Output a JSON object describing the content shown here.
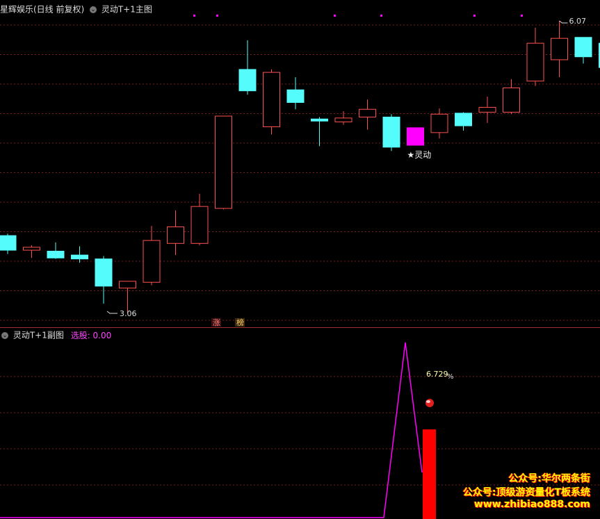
{
  "main_panel": {
    "title": "星辉娱乐(日线 前复权)",
    "indicator_name": "灵动T+1主图",
    "high_label": "6.07",
    "low_label": "3.06",
    "signal_label": "★灵动",
    "tag_zhang": "涨",
    "tag_bang": "榜"
  },
  "sub_panel": {
    "indicator_name": "灵动T+1副图",
    "select_label": "选股: 0.00",
    "percent_label": "6.729",
    "percent_suffix": "%"
  },
  "watermarks": {
    "line1": "公众号:华尔两条街",
    "line2": "公众号:顶级游资量化T板系统",
    "line3": "www.zhibiao888.com"
  },
  "colors": {
    "up": "#ff5050",
    "down": "#54fcfc",
    "signal": "#ff00ff",
    "grid": "#7a1e1e",
    "watermark": "#ffff00",
    "watermark_shadow": "#ff0000"
  },
  "chart_data": {
    "type": "candlestick",
    "price_range": [
      3.0,
      6.2
    ],
    "candles": [
      {
        "o": 3.86,
        "h": 3.88,
        "l": 3.67,
        "c": 3.71
      },
      {
        "o": 3.71,
        "h": 3.76,
        "l": 3.63,
        "c": 3.74,
        "flat": true
      },
      {
        "o": 3.7,
        "h": 3.79,
        "l": 3.62,
        "c": 3.63
      },
      {
        "o": 3.66,
        "h": 3.75,
        "l": 3.58,
        "c": 3.62
      },
      {
        "o": 3.62,
        "h": 3.65,
        "l": 3.16,
        "c": 3.34
      },
      {
        "o": 3.32,
        "h": 3.32,
        "l": 3.06,
        "c": 3.39
      },
      {
        "o": 3.38,
        "h": 3.96,
        "l": 3.35,
        "c": 3.81
      },
      {
        "o": 3.78,
        "h": 4.12,
        "l": 3.66,
        "c": 3.95
      },
      {
        "o": 3.78,
        "h": 4.29,
        "l": 3.76,
        "c": 4.16
      },
      {
        "o": 4.14,
        "h": 4.99,
        "l": 4.13,
        "c": 5.09
      },
      {
        "o": 5.57,
        "h": 5.87,
        "l": 5.31,
        "c": 5.35
      },
      {
        "o": 4.98,
        "h": 5.57,
        "l": 4.9,
        "c": 5.54
      },
      {
        "o": 5.36,
        "h": 5.49,
        "l": 5.16,
        "c": 5.23
      },
      {
        "o": 5.06,
        "h": 5.08,
        "l": 4.78,
        "c": 5.04,
        "thin": true
      },
      {
        "o": 5.03,
        "h": 5.14,
        "l": 5.0,
        "c": 5.07
      },
      {
        "o": 5.08,
        "h": 5.26,
        "l": 4.95,
        "c": 5.16
      },
      {
        "o": 5.08,
        "h": 5.11,
        "l": 4.73,
        "c": 4.77
      },
      {
        "o": 4.97,
        "h": 4.97,
        "l": 4.79,
        "c": 4.79,
        "signal": true
      },
      {
        "o": 4.92,
        "h": 5.17,
        "l": 4.86,
        "c": 5.11
      },
      {
        "o": 5.12,
        "h": 5.13,
        "l": 4.94,
        "c": 4.99
      },
      {
        "o": 5.13,
        "h": 5.29,
        "l": 5.02,
        "c": 5.18
      },
      {
        "o": 5.13,
        "h": 5.47,
        "l": 5.11,
        "c": 5.38
      },
      {
        "o": 5.45,
        "h": 6.0,
        "l": 5.4,
        "c": 5.84
      },
      {
        "o": 5.67,
        "h": 6.07,
        "l": 5.49,
        "c": 5.89
      },
      {
        "o": 5.9,
        "h": 5.9,
        "l": 5.63,
        "c": 5.7
      },
      {
        "o": 5.84,
        "h": 5.98,
        "l": 5.51,
        "c": 5.59
      }
    ]
  }
}
